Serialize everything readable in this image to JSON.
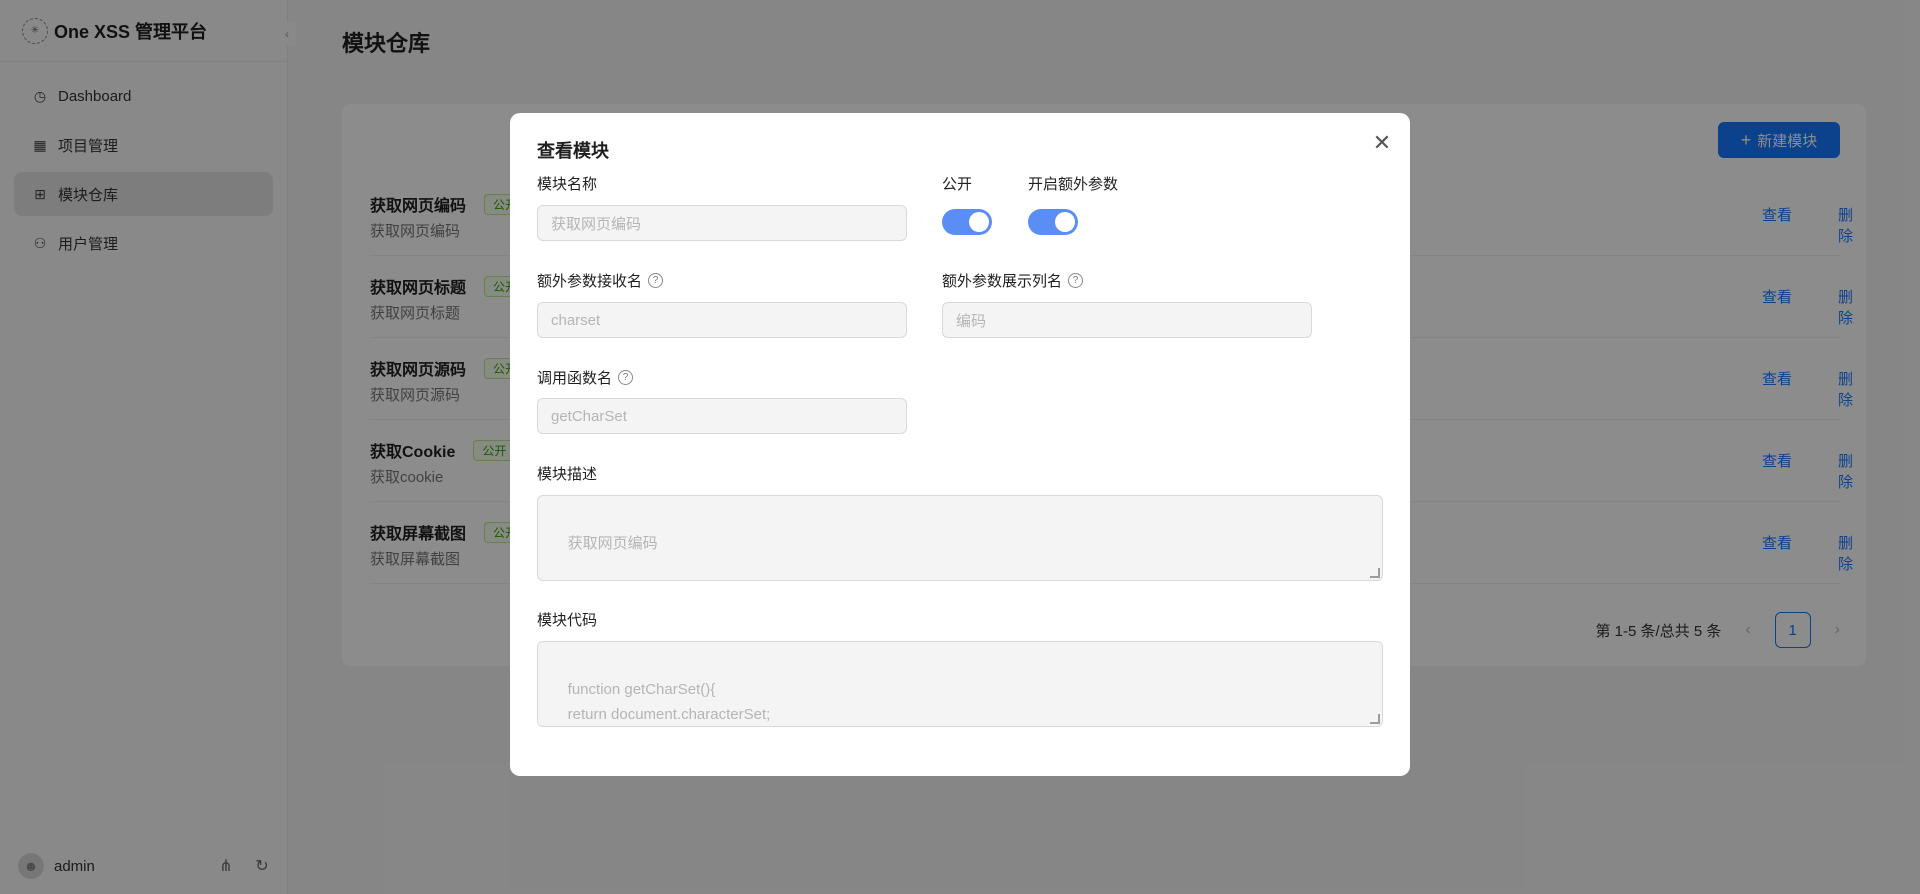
{
  "sidebar": {
    "brand_title": "One XSS 管理平台",
    "collapse_icon": "‹",
    "items": [
      {
        "label": "Dashboard",
        "icon": "dashboard-icon",
        "glyph": "◷"
      },
      {
        "label": "项目管理",
        "icon": "project-icon",
        "glyph": "▦"
      },
      {
        "label": "模块仓库",
        "icon": "module-icon",
        "glyph": "⊞",
        "active": true
      },
      {
        "label": "用户管理",
        "icon": "user-icon",
        "glyph": "⚇"
      }
    ],
    "username": "admin"
  },
  "page": {
    "title": "模块仓库",
    "new_button": "新建模块",
    "rows": [
      {
        "title": "获取网页编码",
        "tag": "公开",
        "desc": "获取网页编码"
      },
      {
        "title": "获取网页标题",
        "tag": "公开",
        "desc": "获取网页标题"
      },
      {
        "title": "获取网页源码",
        "tag": "公开",
        "desc": "获取网页源码"
      },
      {
        "title": "获取Cookie",
        "tag": "公开",
        "desc": "获取cookie"
      },
      {
        "title": "获取屏幕截图",
        "tag": "公开",
        "desc": "获取屏幕截图"
      }
    ],
    "view_label": "查看",
    "delete_label": "删除",
    "pagination": {
      "summary": "第 1-5 条/总共 5 条",
      "current_page": "1"
    }
  },
  "modal": {
    "title": "查看模块",
    "name_label": "模块名称",
    "name_value": "获取网页编码",
    "public_label": "公开",
    "public_on": true,
    "extra_label": "开启额外参数",
    "extra_on": true,
    "extra_recv_label": "额外参数接收名",
    "extra_recv_value": "charset",
    "extra_display_label": "额外参数展示列名",
    "extra_display_value": "编码",
    "func_label": "调用函数名",
    "func_value": "getCharSet",
    "desc_label": "模块描述",
    "desc_value": "获取网页编码",
    "code_label": "模块代码",
    "code_value": "function getCharSet(){\n    return document.characterSet;\n}"
  },
  "colors": {
    "primary": "#1677ff",
    "switch_on": "#5b8ef5",
    "tag_green": "#389e0d"
  }
}
